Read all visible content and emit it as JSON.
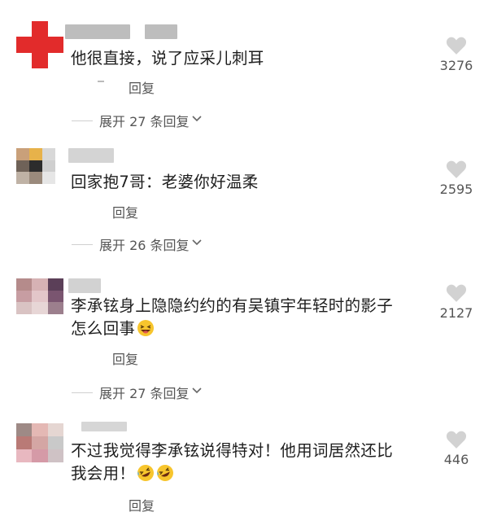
{
  "comments": [
    {
      "text": "他很直接，说了应采儿刺耳",
      "likes": "3276",
      "reply_label": "回复",
      "expand_label": "展开 27 条回复",
      "avatar_colors": [
        "#ffffff",
        "#e22b2b",
        "#ffffff",
        "#e22b2b",
        "#e22b2b",
        "#e22b2b",
        "#ffffff",
        "#e22b2b",
        "#ffffff"
      ]
    },
    {
      "text": "回家抱7哥：老婆你好温柔",
      "likes": "2595",
      "reply_label": "回复",
      "expand_label": "展开 26 条回复",
      "avatar_colors": [
        "#c9a07a",
        "#e7b24a",
        "#d8d8d8",
        "#6f6258",
        "#2c2c2c",
        "#cfcfcf",
        "#bfb2a5",
        "#9a8a7c",
        "#e6e6e6"
      ]
    },
    {
      "text_line1": "李承铉身上隐隐约约的有吴镇宇年轻时的影子",
      "text_line2": "怎么回事",
      "likes": "2127",
      "reply_label": "回复",
      "expand_label": "展开 27 条回复",
      "emoji": "laughing-emoji",
      "avatar_colors": [
        "#b58b8b",
        "#d6b2b4",
        "#5b3f58",
        "#c79da2",
        "#e3c6c9",
        "#7a5570",
        "#d9c3c3",
        "#e7d6d6",
        "#9c7f8d"
      ]
    },
    {
      "text_line1": "不过我觉得李承铉说得特对！他用词居然还比",
      "text_line2": "我会用！",
      "likes": "446",
      "reply_label": "回复",
      "emoji": "rolling-on-floor-laughing-emoji",
      "avatar_colors": [
        "#9e8a86",
        "#e4b8b4",
        "#e5d6d2",
        "#b97a76",
        "#d4a6a4",
        "#c9c9c9",
        "#e8b8c0",
        "#d59aa7",
        "#cfc2c5"
      ]
    }
  ],
  "colors": {
    "text": "#1e1e1e",
    "meta": "#555555",
    "heart": "#d2d2d2",
    "background": "#ffffff"
  },
  "icons": {
    "like": "heart-icon",
    "expand": "chevron-down-icon"
  }
}
